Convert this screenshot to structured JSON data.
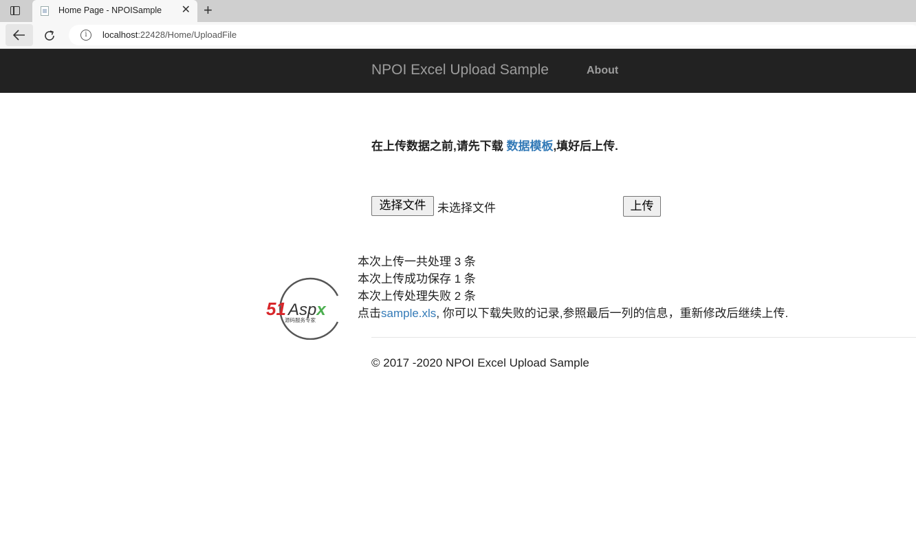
{
  "browser": {
    "tab_title": "Home Page - NPOISample",
    "close_glyph": "✕",
    "new_tab_glyph": "+",
    "url_host": "localhost",
    "url_rest": ":22428/Home/UploadFile"
  },
  "navbar": {
    "brand": "NPOI Excel Upload Sample",
    "about": "About"
  },
  "notice": {
    "before": "在上传数据之前,请先下载 ",
    "link": "数据模板",
    "after": ",填好后上传."
  },
  "upload": {
    "choose_file_label": "选择文件",
    "file_status": "未选择文件",
    "upload_label": "上传"
  },
  "results": {
    "total": "本次上传一共处理 3 条",
    "success": "本次上传成功保存 1 条",
    "failed": "本次上传处理失败 2 条",
    "download_prefix": "点击",
    "download_link": "sample.xls",
    "download_suffix": ", 你可以下载失败的记录,参照最后一列的信息，重新修改后继续上传."
  },
  "logo": {
    "text_51": "51",
    "text_aspx": "Aspx",
    "tagline": "源码服务专家"
  },
  "footer": {
    "copyright": "© 2017 -2020 NPOI Excel Upload Sample"
  }
}
